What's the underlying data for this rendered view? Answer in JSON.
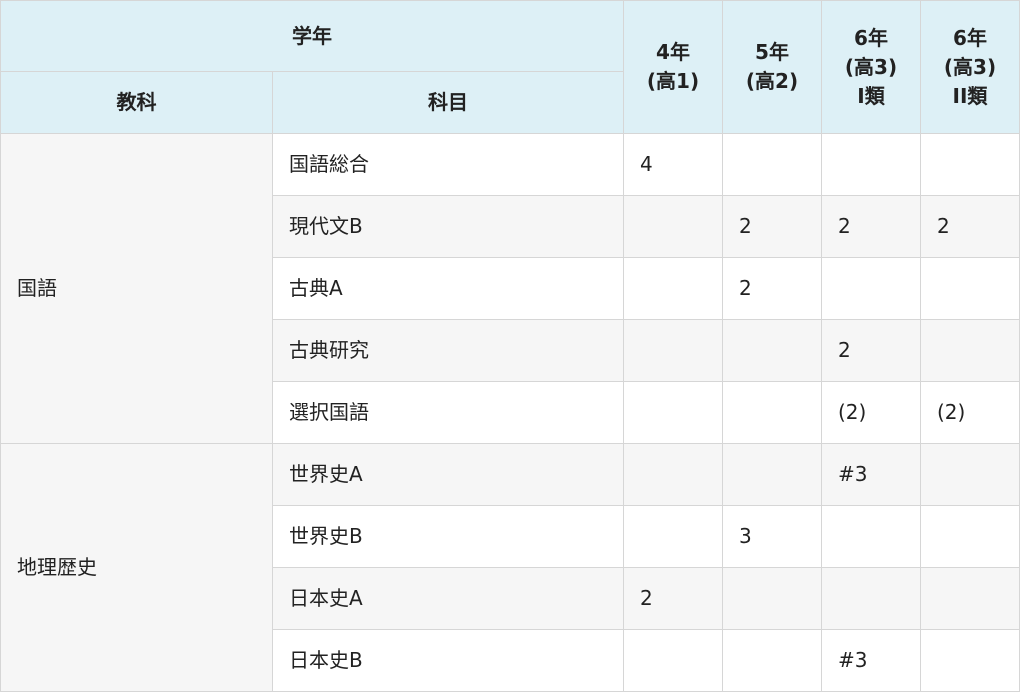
{
  "header": {
    "grade_label": "学年",
    "subject_category_label": "教科",
    "subject_label": "科目",
    "grades": [
      {
        "lines": [
          "4年",
          "(高1)"
        ]
      },
      {
        "lines": [
          "5年",
          "(高2)"
        ]
      },
      {
        "lines": [
          "6年",
          "(高3)",
          "I類"
        ]
      },
      {
        "lines": [
          "6年",
          "(高3)",
          "II類"
        ]
      }
    ]
  },
  "groups": [
    {
      "name": "国語",
      "rows": [
        {
          "subject": "国語総合",
          "values": [
            "4",
            "",
            "",
            ""
          ]
        },
        {
          "subject": "現代文B",
          "values": [
            "",
            "2",
            "2",
            "2"
          ]
        },
        {
          "subject": "古典A",
          "values": [
            "",
            "2",
            "",
            ""
          ]
        },
        {
          "subject": "古典研究",
          "values": [
            "",
            "",
            "2",
            ""
          ]
        },
        {
          "subject": "選択国語",
          "values": [
            "",
            "",
            "(2)",
            "(2)"
          ]
        }
      ]
    },
    {
      "name": "地理歴史",
      "rows": [
        {
          "subject": "世界史A",
          "values": [
            "",
            "",
            "#3",
            ""
          ]
        },
        {
          "subject": "世界史B",
          "values": [
            "",
            "3",
            "",
            ""
          ]
        },
        {
          "subject": "日本史A",
          "values": [
            "2",
            "",
            "",
            ""
          ]
        },
        {
          "subject": "日本史B",
          "values": [
            "",
            "",
            "#3",
            ""
          ]
        }
      ]
    }
  ]
}
